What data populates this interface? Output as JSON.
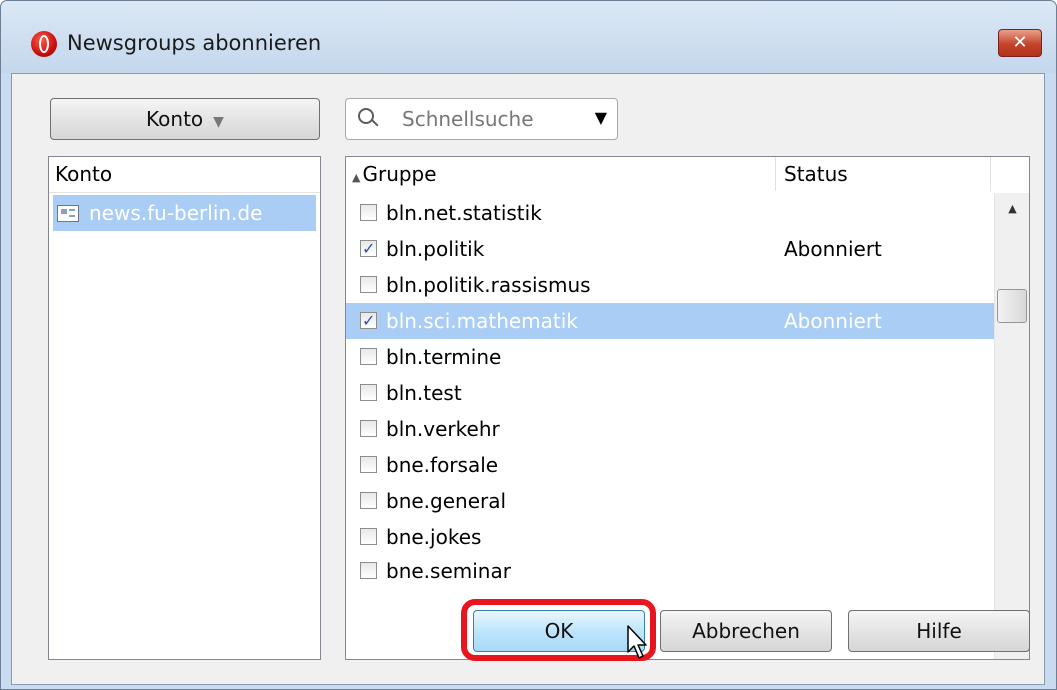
{
  "window": {
    "title": "Newsgroups abonnieren",
    "close_label": "✕"
  },
  "toolbar": {
    "account_button_label": "Konto",
    "search_placeholder": "Schnellsuche"
  },
  "account_list": {
    "header": "Konto",
    "items": [
      {
        "label": "news.fu-berlin.de",
        "selected": true
      }
    ]
  },
  "group_list": {
    "columns": [
      "Gruppe",
      "Status"
    ],
    "sort_column": "Gruppe",
    "rows": [
      {
        "name": "bln.net.statistik",
        "status": "",
        "checked": false
      },
      {
        "name": "bln.politik",
        "status": "Abonniert",
        "checked": true
      },
      {
        "name": "bln.politik.rassismus",
        "status": "",
        "checked": false
      },
      {
        "name": "bln.sci.mathematik",
        "status": "Abonniert",
        "checked": true,
        "selected": true
      },
      {
        "name": "bln.termine",
        "status": "",
        "checked": false
      },
      {
        "name": "bln.test",
        "status": "",
        "checked": false
      },
      {
        "name": "bln.verkehr",
        "status": "",
        "checked": false
      },
      {
        "name": "bne.forsale",
        "status": "",
        "checked": false
      },
      {
        "name": "bne.general",
        "status": "",
        "checked": false
      },
      {
        "name": "bne.jokes",
        "status": "",
        "checked": false
      },
      {
        "name": "bne.seminar",
        "status": "",
        "checked": false
      }
    ]
  },
  "buttons": {
    "ok": "OK",
    "cancel": "Abbrechen",
    "help": "Hilfe"
  },
  "colors": {
    "selection": "#a9cdf5",
    "highlight": "#e8141e"
  }
}
